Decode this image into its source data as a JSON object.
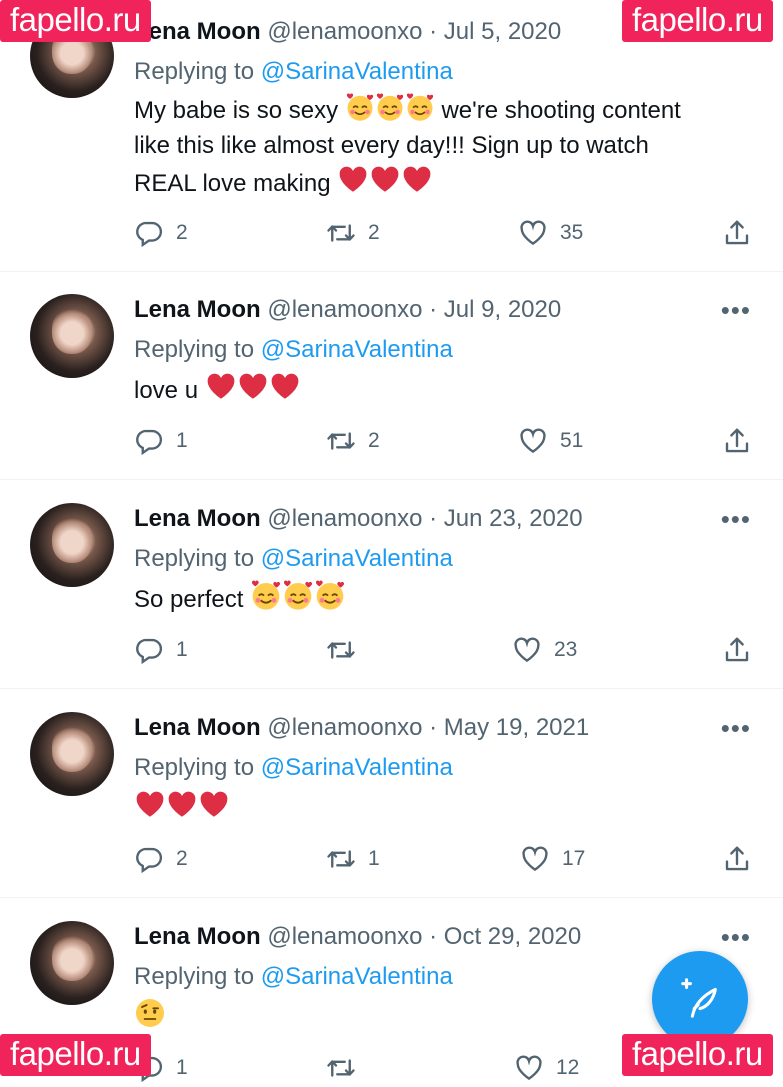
{
  "watermarks": {
    "text": "fapello.ru"
  },
  "reply_prefix": "Replying to",
  "tweets": [
    {
      "name": "Lena Moon",
      "handle": "@lenamoonxo",
      "date": "Jul 5, 2020",
      "reply_to": "@SarinaValentina",
      "text_lines": [
        "My babe is so sexy",
        "we're shooting content",
        "like this like almost every day!!! Sign up to watch",
        "REAL love making"
      ],
      "replies": "2",
      "retweets": "2",
      "likes": "35"
    },
    {
      "name": "Lena Moon",
      "handle": "@lenamoonxo",
      "date": "Jul 9, 2020",
      "reply_to": "@SarinaValentina",
      "text": "love u",
      "replies": "1",
      "retweets": "2",
      "likes": "51"
    },
    {
      "name": "Lena Moon",
      "handle": "@lenamoonxo",
      "date": "Jun 23, 2020",
      "reply_to": "@SarinaValentina",
      "text": "So perfect",
      "replies": "1",
      "retweets": "",
      "likes": "23"
    },
    {
      "name": "Lena Moon",
      "handle": "@lenamoonxo",
      "date": "May 19, 2021",
      "reply_to": "@SarinaValentina",
      "text": "",
      "replies": "2",
      "retweets": "1",
      "likes": "17"
    },
    {
      "name": "Lena Moon",
      "handle": "@lenamoonxo",
      "date": "Oct 29, 2020",
      "reply_to": "@SarinaValentina",
      "text": "",
      "replies": "1",
      "retweets": "",
      "likes": "12"
    }
  ],
  "colors": {
    "accent": "#1d9bf0",
    "heart": "#dd2e44",
    "watermark": "#f0245a"
  },
  "icons": [
    "reply-icon",
    "retweet-icon",
    "like-icon",
    "share-icon",
    "more-icon",
    "heart-emoji",
    "smiling-face-with-hearts-emoji",
    "raised-eyebrow-emoji",
    "compose-icon"
  ]
}
